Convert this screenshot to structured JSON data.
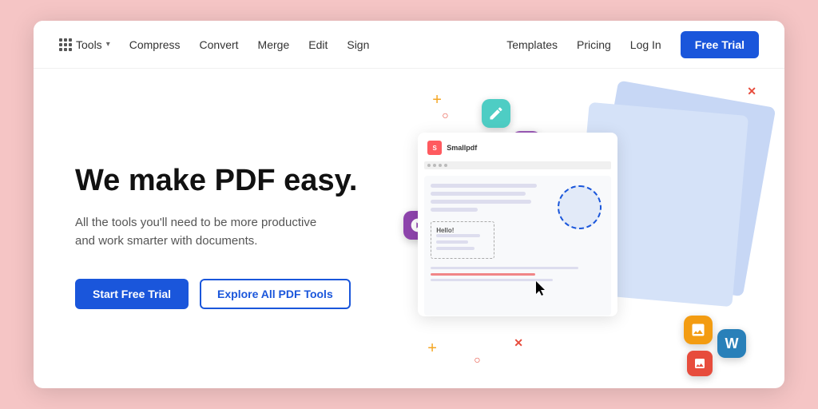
{
  "app": {
    "title": "Smallpdf"
  },
  "navbar": {
    "tools_label": "Tools",
    "compress_label": "Compress",
    "convert_label": "Convert",
    "merge_label": "Merge",
    "edit_label": "Edit",
    "sign_label": "Sign",
    "templates_label": "Templates",
    "pricing_label": "Pricing",
    "login_label": "Log In",
    "free_trial_label": "Free Trial"
  },
  "hero": {
    "title": "We make PDF easy.",
    "subtitle": "All the tools you'll need to be more productive and work smarter with documents.",
    "start_button": "Start Free Trial",
    "explore_button": "Explore All PDF Tools"
  },
  "illustration": {
    "pdf_app_name": "Smallpdf",
    "word_icon": "W",
    "image_icon": "🖼"
  }
}
